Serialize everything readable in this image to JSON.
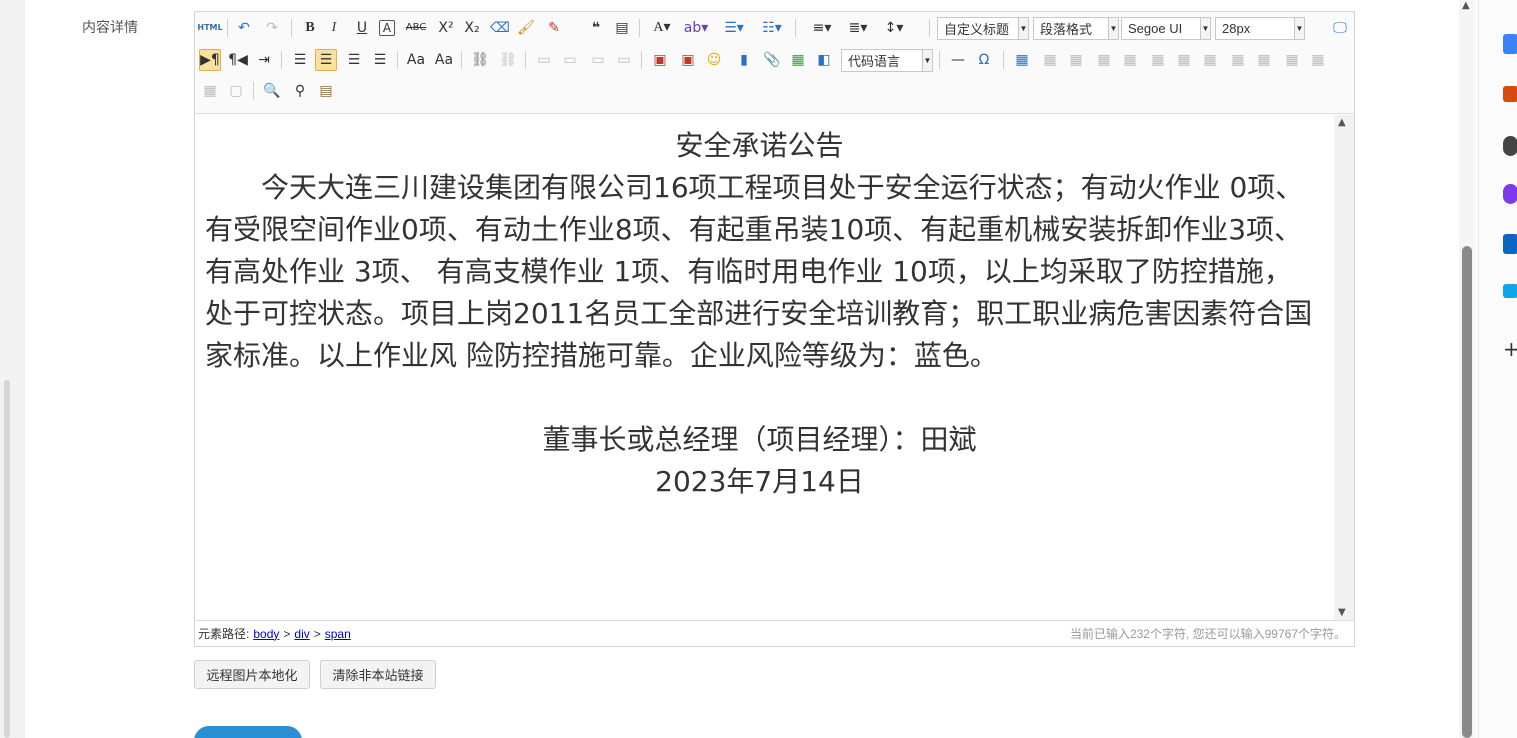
{
  "form": {
    "label": "内容详情"
  },
  "toolbar": {
    "html_label": "HTML",
    "font_family": "Segoe UI",
    "font_size": "28px",
    "custom_heading": "自定义标题",
    "paragraph_format": "段落格式",
    "code_language": "代码语言"
  },
  "content": {
    "title": "安全承诺公告",
    "body": "今天大连三川建设集团有限公司16项工程项目处于安全运行状态；有动火作业 0项、有受限空间作业0项、有动土作业8项、有起重吊装10项、有起重机械安装拆卸作业3项、有高处作业 3项、 有高支模作业 1项、有临时用电作业 10项，以上均采取了防控措施，处于可控状态。项目上岗2011名员工全部进行安全培训教育；职工职业病危害因素符合国家标准。以上作业风 险防控措施可靠。企业风险等级为：蓝色。",
    "signer": "董事长或总经理（项目经理）：田斌",
    "date": "2023年7月14日"
  },
  "status": {
    "path_label": "元素路径:",
    "path": [
      "body",
      "div",
      "span"
    ],
    "path_sep": ">",
    "char_count": "当前已输入232个字符, 您还可以输入99767个字符。"
  },
  "buttons": {
    "localize_images": "远程图片本地化",
    "clear_links": "清除非本站链接"
  },
  "colors": {
    "accent": "#2b8fd6",
    "active_tool": "#fbe0a0",
    "link": "#0000cc"
  }
}
